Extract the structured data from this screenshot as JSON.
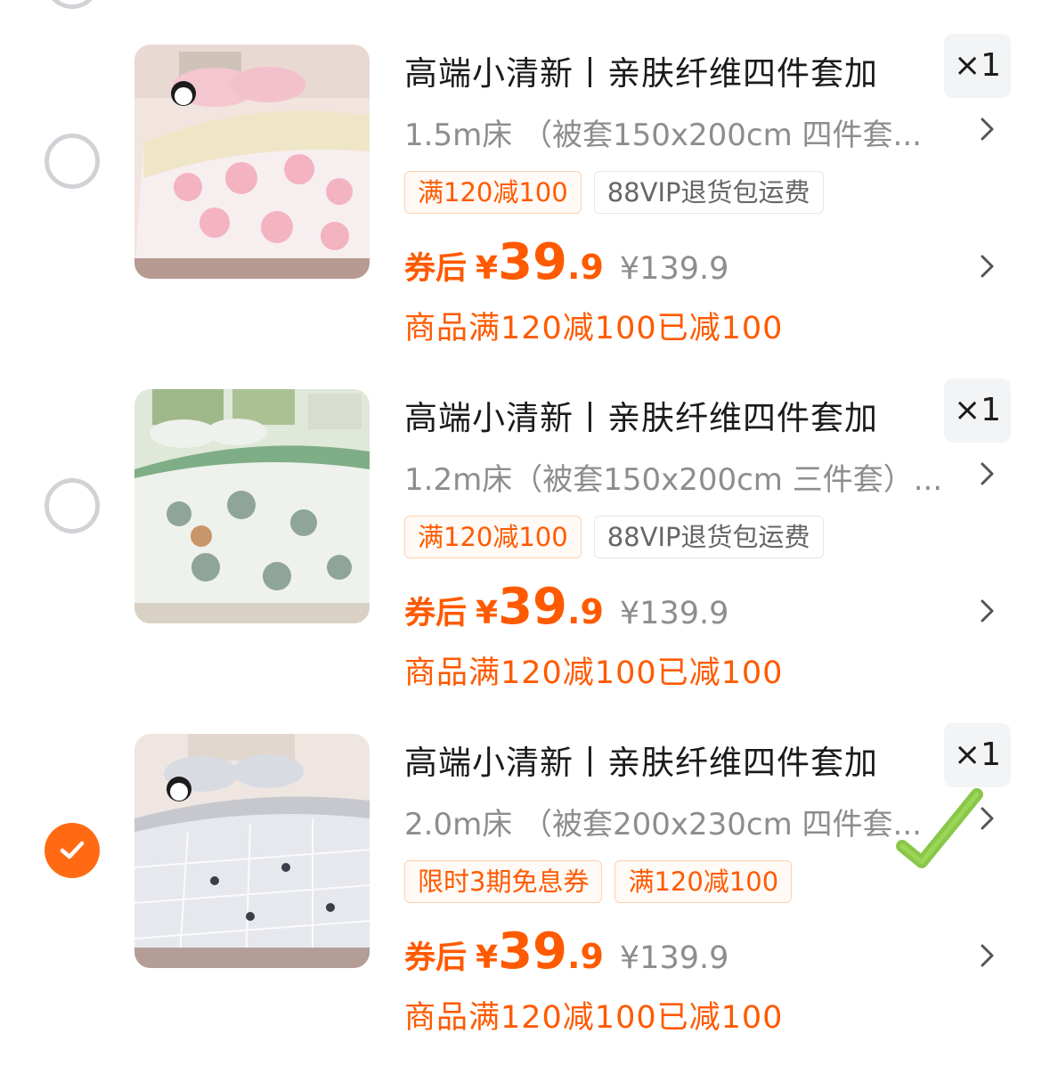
{
  "items": [
    {
      "selected": false,
      "title": "高端小清新丨亲肤纤维四件套加",
      "quantity": "×1",
      "sku": "1.5m床 （被套150x200cm 四件套...",
      "tags": [
        {
          "label": "满120减100",
          "style": "orange"
        },
        {
          "label": "88VIP退货包运费",
          "style": "gray"
        }
      ],
      "price_prefix": "券后",
      "price_currency": "¥",
      "price_int": "39",
      "price_dec": ".9",
      "original_price": "¥139.9",
      "promo_text": "商品满120减100已减100",
      "image_colors": {
        "bg": "#f3e6e2",
        "duvet": "#f7eef0",
        "accent": "#f0aebd",
        "sheet": "#efe6c8"
      }
    },
    {
      "selected": false,
      "title": "高端小清新丨亲肤纤维四件套加",
      "quantity": "×1",
      "sku": "1.2m床（被套150x200cm 三件套）...",
      "tags": [
        {
          "label": "满120减100",
          "style": "orange"
        },
        {
          "label": "88VIP退货包运费",
          "style": "gray"
        }
      ],
      "price_prefix": "券后",
      "price_currency": "¥",
      "price_int": "39",
      "price_dec": ".9",
      "original_price": "¥139.9",
      "promo_text": "商品满120减100已减100",
      "image_colors": {
        "bg": "#e9eee6",
        "duvet": "#eef1ec",
        "accent": "#8fa49a",
        "sheet": "#7fae86"
      }
    },
    {
      "selected": true,
      "title": "高端小清新丨亲肤纤维四件套加",
      "quantity": "×1",
      "sku": "2.0m床 （被套200x230cm 四件套...",
      "tags": [
        {
          "label": "限时3期免息券",
          "style": "orange"
        },
        {
          "label": "满120减100",
          "style": "orange"
        }
      ],
      "price_prefix": "券后",
      "price_currency": "¥",
      "price_int": "39",
      "price_dec": ".9",
      "original_price": "¥139.9",
      "promo_text": "商品满120减100已减100",
      "image_colors": {
        "bg": "#ece6e3",
        "duvet": "#e6e8ee",
        "accent": "#3c3f4a",
        "sheet": "#c7c8ce"
      }
    }
  ],
  "colors": {
    "accent": "#ff5a00",
    "check": "#ff6a13",
    "overlay_check": "#7ec23a"
  }
}
